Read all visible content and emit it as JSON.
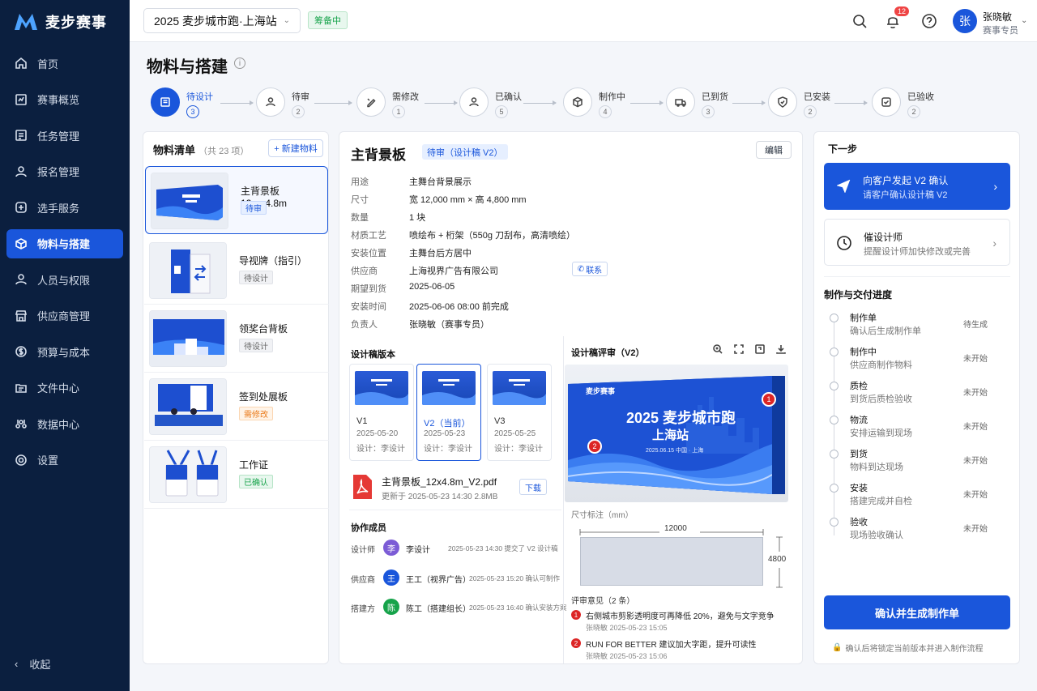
{
  "brand": {
    "name": "麦步赛事"
  },
  "nav": {
    "items": [
      {
        "label": "首页",
        "icon": "home-icon"
      },
      {
        "label": "赛事概览",
        "icon": "chart-icon"
      },
      {
        "label": "任务管理",
        "icon": "task-icon"
      },
      {
        "label": "报名管理",
        "icon": "user-icon"
      },
      {
        "label": "选手服务",
        "icon": "service-icon"
      },
      {
        "label": "物料与搭建",
        "icon": "box-icon",
        "active": true
      },
      {
        "label": "人员与权限",
        "icon": "people-icon"
      },
      {
        "label": "供应商管理",
        "icon": "store-icon"
      },
      {
        "label": "预算与成本",
        "icon": "money-icon"
      },
      {
        "label": "文件中心",
        "icon": "folder-icon"
      },
      {
        "label": "数据中心",
        "icon": "data-icon"
      },
      {
        "label": "设置",
        "icon": "gear-icon"
      }
    ],
    "collapse_label": "收起"
  },
  "topbar": {
    "event": "2025 麦步城市跑·上海站",
    "event_status": "筹备中",
    "notification_count": "12",
    "user": {
      "avatar": "张",
      "name": "张晓敏",
      "role": "赛事专员"
    }
  },
  "page": {
    "title": "物料与搭建"
  },
  "steps": [
    {
      "label": "待设计",
      "count": "3",
      "active": true
    },
    {
      "label": "待审",
      "count": "2"
    },
    {
      "label": "需修改",
      "count": "1"
    },
    {
      "label": "已确认",
      "count": "5"
    },
    {
      "label": "制作中",
      "count": "4"
    },
    {
      "label": "已到货",
      "count": "3"
    },
    {
      "label": "已安装",
      "count": "2"
    },
    {
      "label": "已验收",
      "count": "2"
    }
  ],
  "materials": {
    "title": "物料清单",
    "count": "（共 23 项）",
    "new_label": "+ 新建物料",
    "items": [
      {
        "name": "主背景板  12m×4.8m",
        "status": "待审",
        "tone": "blue"
      },
      {
        "name": "导视牌（指引）",
        "status": "待设计",
        "tone": "gray"
      },
      {
        "name": "领奖台背板",
        "status": "待设计",
        "tone": "gray"
      },
      {
        "name": "签到处展板",
        "status": "需修改",
        "tone": "orange"
      },
      {
        "name": "工作证",
        "status": "已确认",
        "tone": "green"
      }
    ]
  },
  "detail": {
    "title": "主背景板",
    "status": "待审（设计稿 V2）",
    "edit_label": "编辑",
    "attrs": [
      {
        "k": "用途",
        "v": "主舞台背景展示"
      },
      {
        "k": "尺寸",
        "v": "宽 12,000 mm × 高 4,800 mm"
      },
      {
        "k": "数量",
        "v": "1 块"
      },
      {
        "k": "材质工艺",
        "v": "喷绘布 + 桁架（550g 刀刮布，高清喷绘）"
      },
      {
        "k": "安装位置",
        "v": "主舞台后方居中"
      },
      {
        "k": "供应商",
        "v": "上海视界广告有限公司"
      },
      {
        "k": "期望到货",
        "v": "2025-06-05"
      },
      {
        "k": "安装时间",
        "v": "2025-06-06 08:00 前完成"
      },
      {
        "k": "负责人",
        "v": "张晓敏（赛事专员）"
      }
    ],
    "contact_label": "联系",
    "versions_title": "设计稿版本",
    "versions": [
      {
        "name": "V1",
        "date": "2025-05-20",
        "by": "设计：李设计"
      },
      {
        "name": "V2（当前）",
        "date": "2025-05-23",
        "by": "设计：李设计",
        "current": true
      },
      {
        "name": "V3",
        "date": "2025-05-25",
        "by": "设计：李设计"
      }
    ],
    "file": {
      "name": "主背景板_12x4.8m_V2.pdf",
      "meta": "更新于 2025-05-23 14:30   2.8MB",
      "download": "下载"
    },
    "collab_title": "协作成员",
    "collaborators": [
      {
        "role": "设计师",
        "avatar": "李",
        "name": "李设计",
        "note": "2025-05-23 14:30 提交了 V2 设计稿",
        "color": "#7c5cd6"
      },
      {
        "role": "供应商",
        "avatar": "王",
        "name": "王工（视界广告）",
        "note": "2025-05-23 15:20 确认可制作",
        "color": "#1a56db"
      },
      {
        "role": "搭建方",
        "avatar": "陈",
        "name": "陈工（搭建组长）",
        "note": "2025-05-23 16:40 确认安装方案",
        "color": "#16a34a"
      }
    ]
  },
  "review": {
    "title": "设计稿评审（V2）",
    "preview_brand": "麦步赛事",
    "preview_line1": "2025 麦步城市跑",
    "preview_line2": "上海站",
    "preview_date": "2025.06.15   中国 · 上海",
    "pins": [
      "1",
      "2"
    ],
    "dim_title": "尺寸标注（mm）",
    "dim_w": "12000",
    "dim_h": "4800",
    "comments_title": "评审意见（2 条）",
    "comments": [
      {
        "num": "1",
        "text": "右侧城市剪影透明度可再降低 20%，避免与文字竞争",
        "meta": "张晓敏    2025-05-23 15:05"
      },
      {
        "num": "2",
        "text": "RUN FOR BETTER 建议加大字距，提升可读性",
        "meta": "张晓敏    2025-05-23 15:06"
      }
    ]
  },
  "next": {
    "title": "下一步",
    "primary": {
      "title": "向客户发起 V2 确认",
      "sub": "请客户确认设计稿 V2"
    },
    "secondary": {
      "title": "催设计师",
      "sub": "提醒设计师加快修改或完善"
    },
    "progress_title": "制作与交付进度",
    "timeline": [
      {
        "name": "制作单",
        "desc": "确认后生成制作单",
        "status": "待生成"
      },
      {
        "name": "制作中",
        "desc": "供应商制作物料",
        "status": "未开始"
      },
      {
        "name": "质检",
        "desc": "到货后质检验收",
        "status": "未开始"
      },
      {
        "name": "物流",
        "desc": "安排运输到现场",
        "status": "未开始"
      },
      {
        "name": "到货",
        "desc": "物料到达现场",
        "status": "未开始"
      },
      {
        "name": "安装",
        "desc": "搭建完成并自检",
        "status": "未开始"
      },
      {
        "name": "验收",
        "desc": "现场验收确认",
        "status": "未开始"
      }
    ],
    "confirm_label": "确认并生成制作单",
    "confirm_note": "确认后将锁定当前版本并进入制作流程"
  }
}
